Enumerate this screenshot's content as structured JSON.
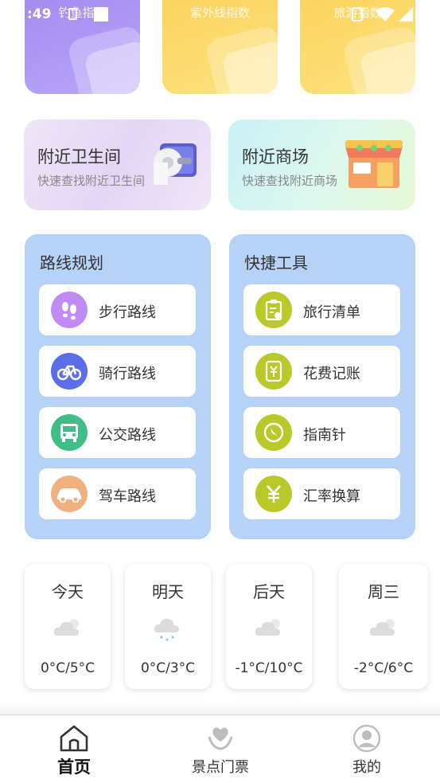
{
  "status_bar": {
    "time": ":49"
  },
  "index_cards": [
    {
      "label": "钓鱼指数"
    },
    {
      "label": "紫外线指数"
    },
    {
      "label": "旅游指数"
    }
  ],
  "nearby": [
    {
      "title": "附近卫生间",
      "subtitle": "快速查找附近卫生间",
      "icon": "toilet-paper-icon"
    },
    {
      "title": "附近商场",
      "subtitle": "快速查找附近商场",
      "icon": "shop-icon"
    }
  ],
  "route_panel": {
    "title": "路线规划",
    "items": [
      {
        "label": "步行路线",
        "icon": "footprints-icon",
        "color": "#c08bf2"
      },
      {
        "label": "骑行路线",
        "icon": "bicycle-icon",
        "color": "#5b6ee8"
      },
      {
        "label": "公交路线",
        "icon": "bus-icon",
        "color": "#3fbf86"
      },
      {
        "label": "驾车路线",
        "icon": "car-icon",
        "color": "#f0b07f"
      }
    ]
  },
  "tools_panel": {
    "title": "快捷工具",
    "items": [
      {
        "label": "旅行清单",
        "icon": "checklist-icon",
        "color": "#b9c92a"
      },
      {
        "label": "花费记账",
        "icon": "ledger-icon",
        "color": "#b9c92a"
      },
      {
        "label": "指南针",
        "icon": "compass-icon",
        "color": "#b9c92a"
      },
      {
        "label": "汇率换算",
        "icon": "yuan-icon",
        "color": "#b9c92a"
      }
    ]
  },
  "weather": [
    {
      "day": "今天",
      "temp": "0°C/5°C",
      "icon": "cloudy-icon"
    },
    {
      "day": "明天",
      "temp": "0°C/3°C",
      "icon": "snow-icon"
    },
    {
      "day": "后天",
      "temp": "-1°C/10°C",
      "icon": "cloudy-icon"
    },
    {
      "day": "周三",
      "temp": "-2°C/6°C",
      "icon": "cloudy-icon"
    }
  ],
  "bottom_nav": [
    {
      "label": "首页",
      "icon": "home-icon",
      "active": true
    },
    {
      "label": "景点门票",
      "icon": "ticket-heart-icon",
      "active": false
    },
    {
      "label": "我的",
      "icon": "profile-icon",
      "active": false
    }
  ],
  "colors": {
    "panel_bg": "#b7d2f7",
    "accent_purple": "#a48cf0",
    "accent_yellow": "#fbd45f"
  }
}
